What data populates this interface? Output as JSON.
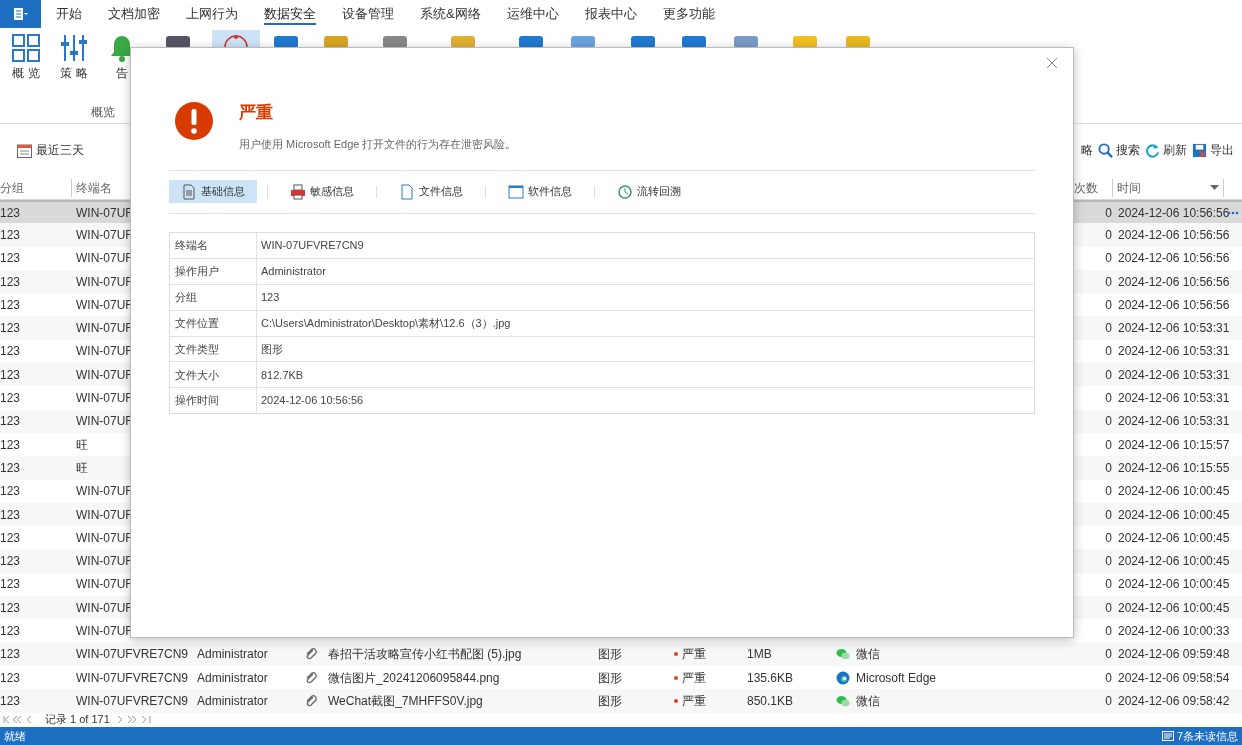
{
  "ribbon_tabs": [
    {
      "label": "开始",
      "selected": false
    },
    {
      "label": "文档加密",
      "selected": false
    },
    {
      "label": "上网行为",
      "selected": false
    },
    {
      "label": "数据安全",
      "selected": true
    },
    {
      "label": "设备管理",
      "selected": false
    },
    {
      "label": "系统&网络",
      "selected": false
    },
    {
      "label": "运维中心",
      "selected": false
    },
    {
      "label": "报表中心",
      "selected": false
    },
    {
      "label": "更多功能",
      "selected": false
    }
  ],
  "ribbon": {
    "buttons": [
      {
        "label": "概 览",
        "kind": "grid"
      },
      {
        "label": "策 略",
        "kind": "sliders"
      },
      {
        "label": "告",
        "kind": "bell"
      }
    ],
    "group_label": "概览"
  },
  "toolbar": {
    "date_filter": "最近三天",
    "actions": [
      {
        "label": "略",
        "kind": "none"
      },
      {
        "label": "搜索",
        "kind": "search"
      },
      {
        "label": "刷新",
        "kind": "refresh"
      },
      {
        "label": "导出",
        "kind": "export"
      }
    ]
  },
  "table": {
    "columns": [
      {
        "label": "分组"
      },
      {
        "label": "终端名"
      },
      {
        "label": "次数"
      },
      {
        "label": "时间"
      }
    ],
    "rows": [
      {
        "group": "123",
        "terminal": "WIN-07UF",
        "count": "0",
        "time": "2024-12-06 10:56:56",
        "selected": true
      },
      {
        "group": "123",
        "terminal": "WIN-07UF",
        "count": "0",
        "time": "2024-12-06 10:56:56",
        "selected": false
      },
      {
        "group": "123",
        "terminal": "WIN-07UF",
        "count": "0",
        "time": "2024-12-06 10:56:56",
        "selected": false
      },
      {
        "group": "123",
        "terminal": "WIN-07UF",
        "count": "0",
        "time": "2024-12-06 10:56:56",
        "selected": false
      },
      {
        "group": "123",
        "terminal": "WIN-07UF",
        "count": "0",
        "time": "2024-12-06 10:56:56",
        "selected": false
      },
      {
        "group": "123",
        "terminal": "WIN-07UF",
        "count": "0",
        "time": "2024-12-06 10:53:31",
        "selected": false
      },
      {
        "group": "123",
        "terminal": "WIN-07UF",
        "count": "0",
        "time": "2024-12-06 10:53:31",
        "selected": false
      },
      {
        "group": "123",
        "terminal": "WIN-07UF",
        "count": "0",
        "time": "2024-12-06 10:53:31",
        "selected": false
      },
      {
        "group": "123",
        "terminal": "WIN-07UF",
        "count": "0",
        "time": "2024-12-06 10:53:31",
        "selected": false
      },
      {
        "group": "123",
        "terminal": "WIN-07UF",
        "count": "0",
        "time": "2024-12-06 10:53:31",
        "selected": false
      },
      {
        "group": "123",
        "terminal": "旺",
        "count": "0",
        "time": "2024-12-06 10:15:57",
        "selected": false
      },
      {
        "group": "123",
        "terminal": "旺",
        "count": "0",
        "time": "2024-12-06 10:15:55",
        "selected": false
      },
      {
        "group": "123",
        "terminal": "WIN-07UF",
        "count": "0",
        "time": "2024-12-06 10:00:45",
        "selected": false
      },
      {
        "group": "123",
        "terminal": "WIN-07UF",
        "count": "0",
        "time": "2024-12-06 10:00:45",
        "selected": false
      },
      {
        "group": "123",
        "terminal": "WIN-07UF",
        "count": "0",
        "time": "2024-12-06 10:00:45",
        "selected": false
      },
      {
        "group": "123",
        "terminal": "WIN-07UF",
        "count": "0",
        "time": "2024-12-06 10:00:45",
        "selected": false
      },
      {
        "group": "123",
        "terminal": "WIN-07UF",
        "count": "0",
        "time": "2024-12-06 10:00:45",
        "selected": false
      },
      {
        "group": "123",
        "terminal": "WIN-07UF",
        "count": "0",
        "time": "2024-12-06 10:00:45",
        "selected": false
      },
      {
        "group": "123",
        "terminal": "WIN-07UF",
        "count": "0",
        "time": "2024-12-06 10:00:33",
        "selected": false
      },
      {
        "group": "123",
        "terminal": "WIN-07UFVRE7CN9",
        "user": "Administrator",
        "file": "春招干活攻略宣传小红书配图 (5).jpg",
        "type": "图形",
        "level": "严重",
        "size": "1MB",
        "software": {
          "name": "微信",
          "kind": "wechat"
        },
        "count": "0",
        "time": "2024-12-06 09:59:48",
        "selected": false
      },
      {
        "group": "123",
        "terminal": "WIN-07UFVRE7CN9",
        "user": "Administrator",
        "file": "微信图片_20241206095844.png",
        "type": "图形",
        "level": "严重",
        "size": "135.6KB",
        "software": {
          "name": "Microsoft Edge",
          "kind": "edge"
        },
        "count": "0",
        "time": "2024-12-06 09:58:54",
        "selected": false
      },
      {
        "group": "123",
        "terminal": "WIN-07UFVRE7CN9",
        "user": "Administrator",
        "file": "WeChat截图_7MHFFS0V.jpg",
        "type": "图形",
        "level": "严重",
        "size": "850.1KB",
        "software": {
          "name": "微信",
          "kind": "wechat"
        },
        "count": "0",
        "time": "2024-12-06 09:58:42",
        "selected": false
      }
    ]
  },
  "pager": {
    "text": "记录 1 of 171"
  },
  "status_bar": {
    "left": "就绪",
    "right": "7条未读信息"
  },
  "dialog": {
    "title": "严重",
    "description": "用户使用 Microsoft Edge 打开文件的行为存在泄密风险。",
    "tabs": [
      {
        "label": "基础信息",
        "kind": "doc",
        "selected": true
      },
      {
        "label": "敏感信息",
        "kind": "printer",
        "selected": false
      },
      {
        "label": "文件信息",
        "kind": "file",
        "selected": false
      },
      {
        "label": "软件信息",
        "kind": "window",
        "selected": false
      },
      {
        "label": "流转回溯",
        "kind": "history",
        "selected": false
      }
    ],
    "fields": [
      {
        "label": "终端名",
        "value": "WIN-07UFVRE7CN9"
      },
      {
        "label": "操作用户",
        "value": "Administrator"
      },
      {
        "label": "分组",
        "value": "123"
      },
      {
        "label": "文件位置",
        "value": "C:\\Users\\Administrator\\Desktop\\素材\\12.6（3）.jpg"
      },
      {
        "label": "文件类型",
        "value": "图形"
      },
      {
        "label": "文件大小",
        "value": "812.7KB"
      },
      {
        "label": "操作时间",
        "value": "2024-12-06 10:56:56"
      }
    ]
  }
}
